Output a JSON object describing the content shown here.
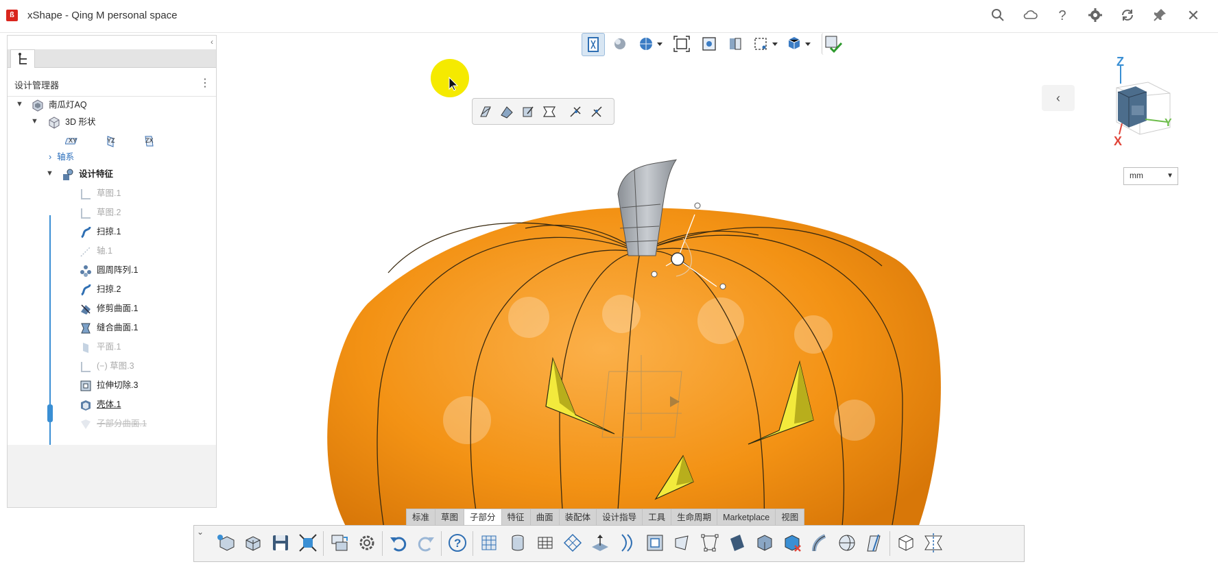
{
  "app": {
    "title": "xShape - Qing M personal space",
    "logo_glyph": "ß"
  },
  "titlebar_icons": [
    "search-icon",
    "cloud-icon",
    "help-icon",
    "gear-icon",
    "sync-icon",
    "pin-icon",
    "close-icon"
  ],
  "panel": {
    "collapse_glyph": "‹",
    "header_title": "设计管理器",
    "menu_glyph": "⋮"
  },
  "tree": {
    "root": "南瓜灯AQ",
    "shape": "3D 形状",
    "planes": [
      "XY",
      "YZ",
      "ZX"
    ],
    "axes": "轴系",
    "features": "设计特征",
    "items": [
      {
        "label": "草图.1",
        "state": "dim"
      },
      {
        "label": "草图.2",
        "state": "dim"
      },
      {
        "label": "扫掠.1",
        "state": "normal"
      },
      {
        "label": "轴.1",
        "state": "dim"
      },
      {
        "label": "圆周阵列.1",
        "state": "normal"
      },
      {
        "label": "扫掠.2",
        "state": "normal"
      },
      {
        "label": "修剪曲面.1",
        "state": "normal"
      },
      {
        "label": "缝合曲面.1",
        "state": "normal"
      },
      {
        "label": "平面.1",
        "state": "dim"
      },
      {
        "label": "(−)  草图.3",
        "state": "dim"
      },
      {
        "label": "拉伸切除.3",
        "state": "normal"
      },
      {
        "label": "壳体.1",
        "state": "selected"
      },
      {
        "label": "子部分曲面.1",
        "state": "struck"
      }
    ]
  },
  "viewport": {
    "unit": "mm",
    "triad": {
      "x": "X",
      "y": "Y",
      "z": "Z"
    },
    "colors": {
      "pumpkin": "#f39214",
      "face": "#f3ea3c",
      "stem": "#a9adb3",
      "accent": "#3a8fd4"
    }
  },
  "bottom_tabs": [
    {
      "label": "标准",
      "active": false
    },
    {
      "label": "草图",
      "active": false
    },
    {
      "label": "子部分",
      "active": true
    },
    {
      "label": "特征",
      "active": false
    },
    {
      "label": "曲面",
      "active": false
    },
    {
      "label": "装配体",
      "active": false
    },
    {
      "label": "设计指导",
      "active": false
    },
    {
      "label": "工具",
      "active": false
    },
    {
      "label": "生命周期",
      "active": false
    },
    {
      "label": "Marketplace",
      "active": false
    },
    {
      "label": "视图",
      "active": false
    }
  ]
}
